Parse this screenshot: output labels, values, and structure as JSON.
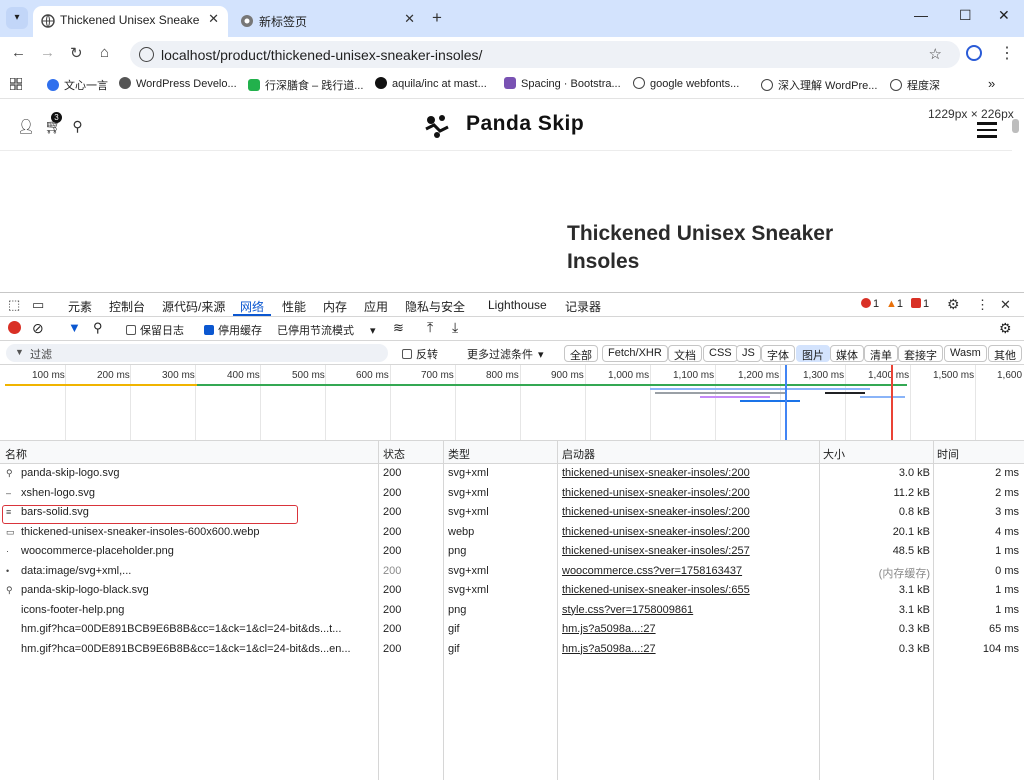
{
  "browser": {
    "tabs": [
      {
        "title": "Thickened Unisex Sneaker Insoles – Panda Skip",
        "active": true
      },
      {
        "title": "新标签页",
        "active": false
      }
    ],
    "url": "localhost/product/thickened-unisex-sneaker-insoles/",
    "bookmarks": [
      {
        "label": "文心一言",
        "color": "#2f6fed"
      },
      {
        "label": "WordPress Develo...",
        "color": "#555555"
      },
      {
        "label": "行深膳食 – 践行道...",
        "color": "#22b14c"
      },
      {
        "label": "aquila/inc at mast...",
        "color": "#111111"
      },
      {
        "label": "Spacing · Bootstra...",
        "color": "#7952b3"
      },
      {
        "label": "google webfonts...",
        "color": "#444444"
      },
      {
        "label": "深入理解 WordPre...",
        "color": "#444444"
      },
      {
        "label": "程度深",
        "color": "#444444"
      }
    ]
  },
  "page": {
    "cart_count": "3",
    "logo_text": "Panda Skip",
    "dimensions_overlay": "1229px × 226px",
    "product_title": "Thickened Unisex Sneaker Insoles"
  },
  "devtools": {
    "tabs": [
      "元素",
      "控制台",
      "源代码/来源",
      "网络",
      "性能",
      "内存",
      "应用",
      "隐私与安全",
      "Lighthouse",
      "记录器"
    ],
    "active_tab": "网络",
    "issues": {
      "errors": "1",
      "warnings": "1",
      "other": "1"
    },
    "toolbar": {
      "preserve_log": "保留日志",
      "disable_cache": "停用缓存",
      "throttling": "已停用节流模式"
    },
    "filter": {
      "placeholder": "过滤",
      "invert": "反转",
      "more_filters": "更多过滤条件",
      "types": [
        "全部",
        "Fetch/XHR",
        "文档",
        "CSS",
        "JS",
        "字体",
        "图片",
        "媒体",
        "清单",
        "套接字",
        "Wasm",
        "其他"
      ],
      "active_type": "图片"
    },
    "timeline": {
      "ticks": [
        "100 ms",
        "200 ms",
        "300 ms",
        "400 ms",
        "500 ms",
        "600 ms",
        "700 ms",
        "800 ms",
        "900 ms",
        "1,000 ms",
        "1,100 ms",
        "1,200 ms",
        "1,300 ms",
        "1,400 ms",
        "1,500 ms",
        "1,600"
      ]
    },
    "columns": {
      "name": "名称",
      "status": "状态",
      "type": "类型",
      "initiator": "启动器",
      "size": "大小",
      "time": "时间"
    },
    "requests": [
      {
        "name": "panda-skip-logo.svg",
        "status": "200",
        "type": "svg+xml",
        "initiator": "thickened-unisex-sneaker-insoles/:200",
        "size": "3.0 kB",
        "time": "2 ms",
        "icon": "panda-icon"
      },
      {
        "name": "xshen-logo.svg",
        "status": "200",
        "type": "svg+xml",
        "initiator": "thickened-unisex-sneaker-insoles/:200",
        "size": "11.2 kB",
        "time": "2 ms",
        "icon": "dash-icon"
      },
      {
        "name": "bars-solid.svg",
        "status": "200",
        "type": "svg+xml",
        "initiator": "thickened-unisex-sneaker-insoles/:200",
        "size": "0.8 kB",
        "time": "3 ms",
        "icon": "bars-icon"
      },
      {
        "name": "thickened-unisex-sneaker-insoles-600x600.webp",
        "status": "200",
        "type": "webp",
        "initiator": "thickened-unisex-sneaker-insoles/:200",
        "size": "20.1 kB",
        "time": "4 ms",
        "icon": "image-icon",
        "highlighted": true
      },
      {
        "name": "woocommerce-placeholder.png",
        "status": "200",
        "type": "png",
        "initiator": "thickened-unisex-sneaker-insoles/:257",
        "size": "48.5 kB",
        "time": "1 ms",
        "icon": "image-icon"
      },
      {
        "name": "data:image/svg+xml,...",
        "status": "200",
        "type": "svg+xml",
        "initiator": "woocommerce.css?ver=1758163437",
        "size": "(内存缓存)",
        "time": "0 ms",
        "icon": "dot-icon",
        "dim": true
      },
      {
        "name": "panda-skip-logo-black.svg",
        "status": "200",
        "type": "svg+xml",
        "initiator": "thickened-unisex-sneaker-insoles/:655",
        "size": "3.1 kB",
        "time": "1 ms",
        "icon": "panda-icon"
      },
      {
        "name": "icons-footer-help.png",
        "status": "200",
        "type": "png",
        "initiator": "style.css?ver=1758009861",
        "size": "3.1 kB",
        "time": "1 ms",
        "icon": "image-icon"
      },
      {
        "name": "hm.gif?hca=00DE891BCB9E6B8B&cc=1&ck=1&cl=24-bit&ds...t...",
        "status": "200",
        "type": "gif",
        "initiator": "hm.js?a5098a...:27",
        "size": "0.3 kB",
        "time": "65 ms",
        "icon": "blank-icon"
      },
      {
        "name": "hm.gif?hca=00DE891BCB9E6B8B&cc=1&ck=1&cl=24-bit&ds...en...",
        "status": "200",
        "type": "gif",
        "initiator": "hm.js?a5098a...:27",
        "size": "0.3 kB",
        "time": "104 ms",
        "icon": "blank-icon"
      }
    ]
  }
}
